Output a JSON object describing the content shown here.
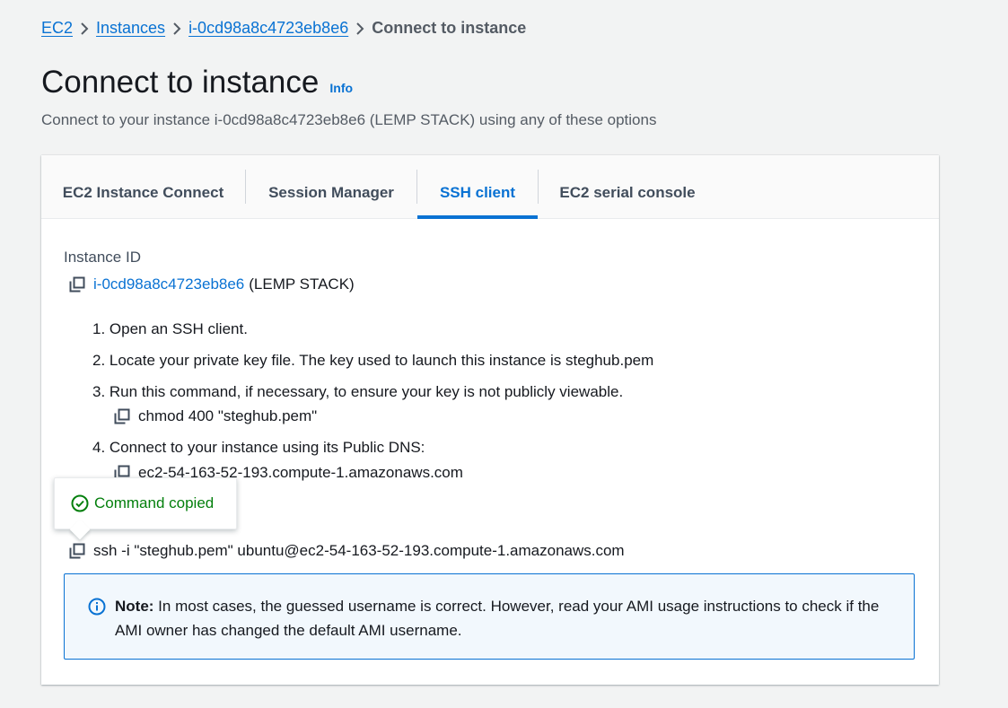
{
  "breadcrumb": {
    "items": [
      "EC2",
      "Instances",
      "i-0cd98a8c4723eb8e6"
    ],
    "current": "Connect to instance"
  },
  "header": {
    "title": "Connect to instance",
    "info_link": "Info",
    "description": "Connect to your instance i-0cd98a8c4723eb8e6 (LEMP STACK) using any of these options"
  },
  "tabs": [
    {
      "label": "EC2 Instance Connect",
      "active": false
    },
    {
      "label": "Session Manager",
      "active": false
    },
    {
      "label": "SSH client",
      "active": true
    },
    {
      "label": "EC2 serial console",
      "active": false
    }
  ],
  "ssh": {
    "instance_id_label": "Instance ID",
    "instance_id": "i-0cd98a8c4723eb8e6",
    "instance_name": "(LEMP STACK)",
    "steps": [
      "1. Open an SSH client.",
      "2. Locate your private key file. The key used to launch this instance is steghub.pem",
      "3. Run this command, if necessary, to ensure your key is not publicly viewable.",
      "4. Connect to your instance using its Public DNS:"
    ],
    "chmod_command": "chmod 400 \"steghub.pem\"",
    "public_dns": "ec2-54-163-52-193.compute-1.amazonaws.com",
    "ssh_command": "ssh -i \"steghub.pem\" ubuntu@ec2-54-163-52-193.compute-1.amazonaws.com"
  },
  "tooltip": {
    "text": "Command copied"
  },
  "note": {
    "bold": "Note:",
    "text": " In most cases, the guessed username is correct. However, read your AMI usage instructions to check if the AMI owner has changed the default AMI username."
  },
  "colors": {
    "link": "#0972d3",
    "success": "#037f0c",
    "note_bg": "#f2f8fd",
    "background": "#f2f3f3"
  },
  "icons": [
    "chevron-right-icon",
    "copy-icon",
    "check-circle-icon",
    "info-circle-icon"
  ]
}
